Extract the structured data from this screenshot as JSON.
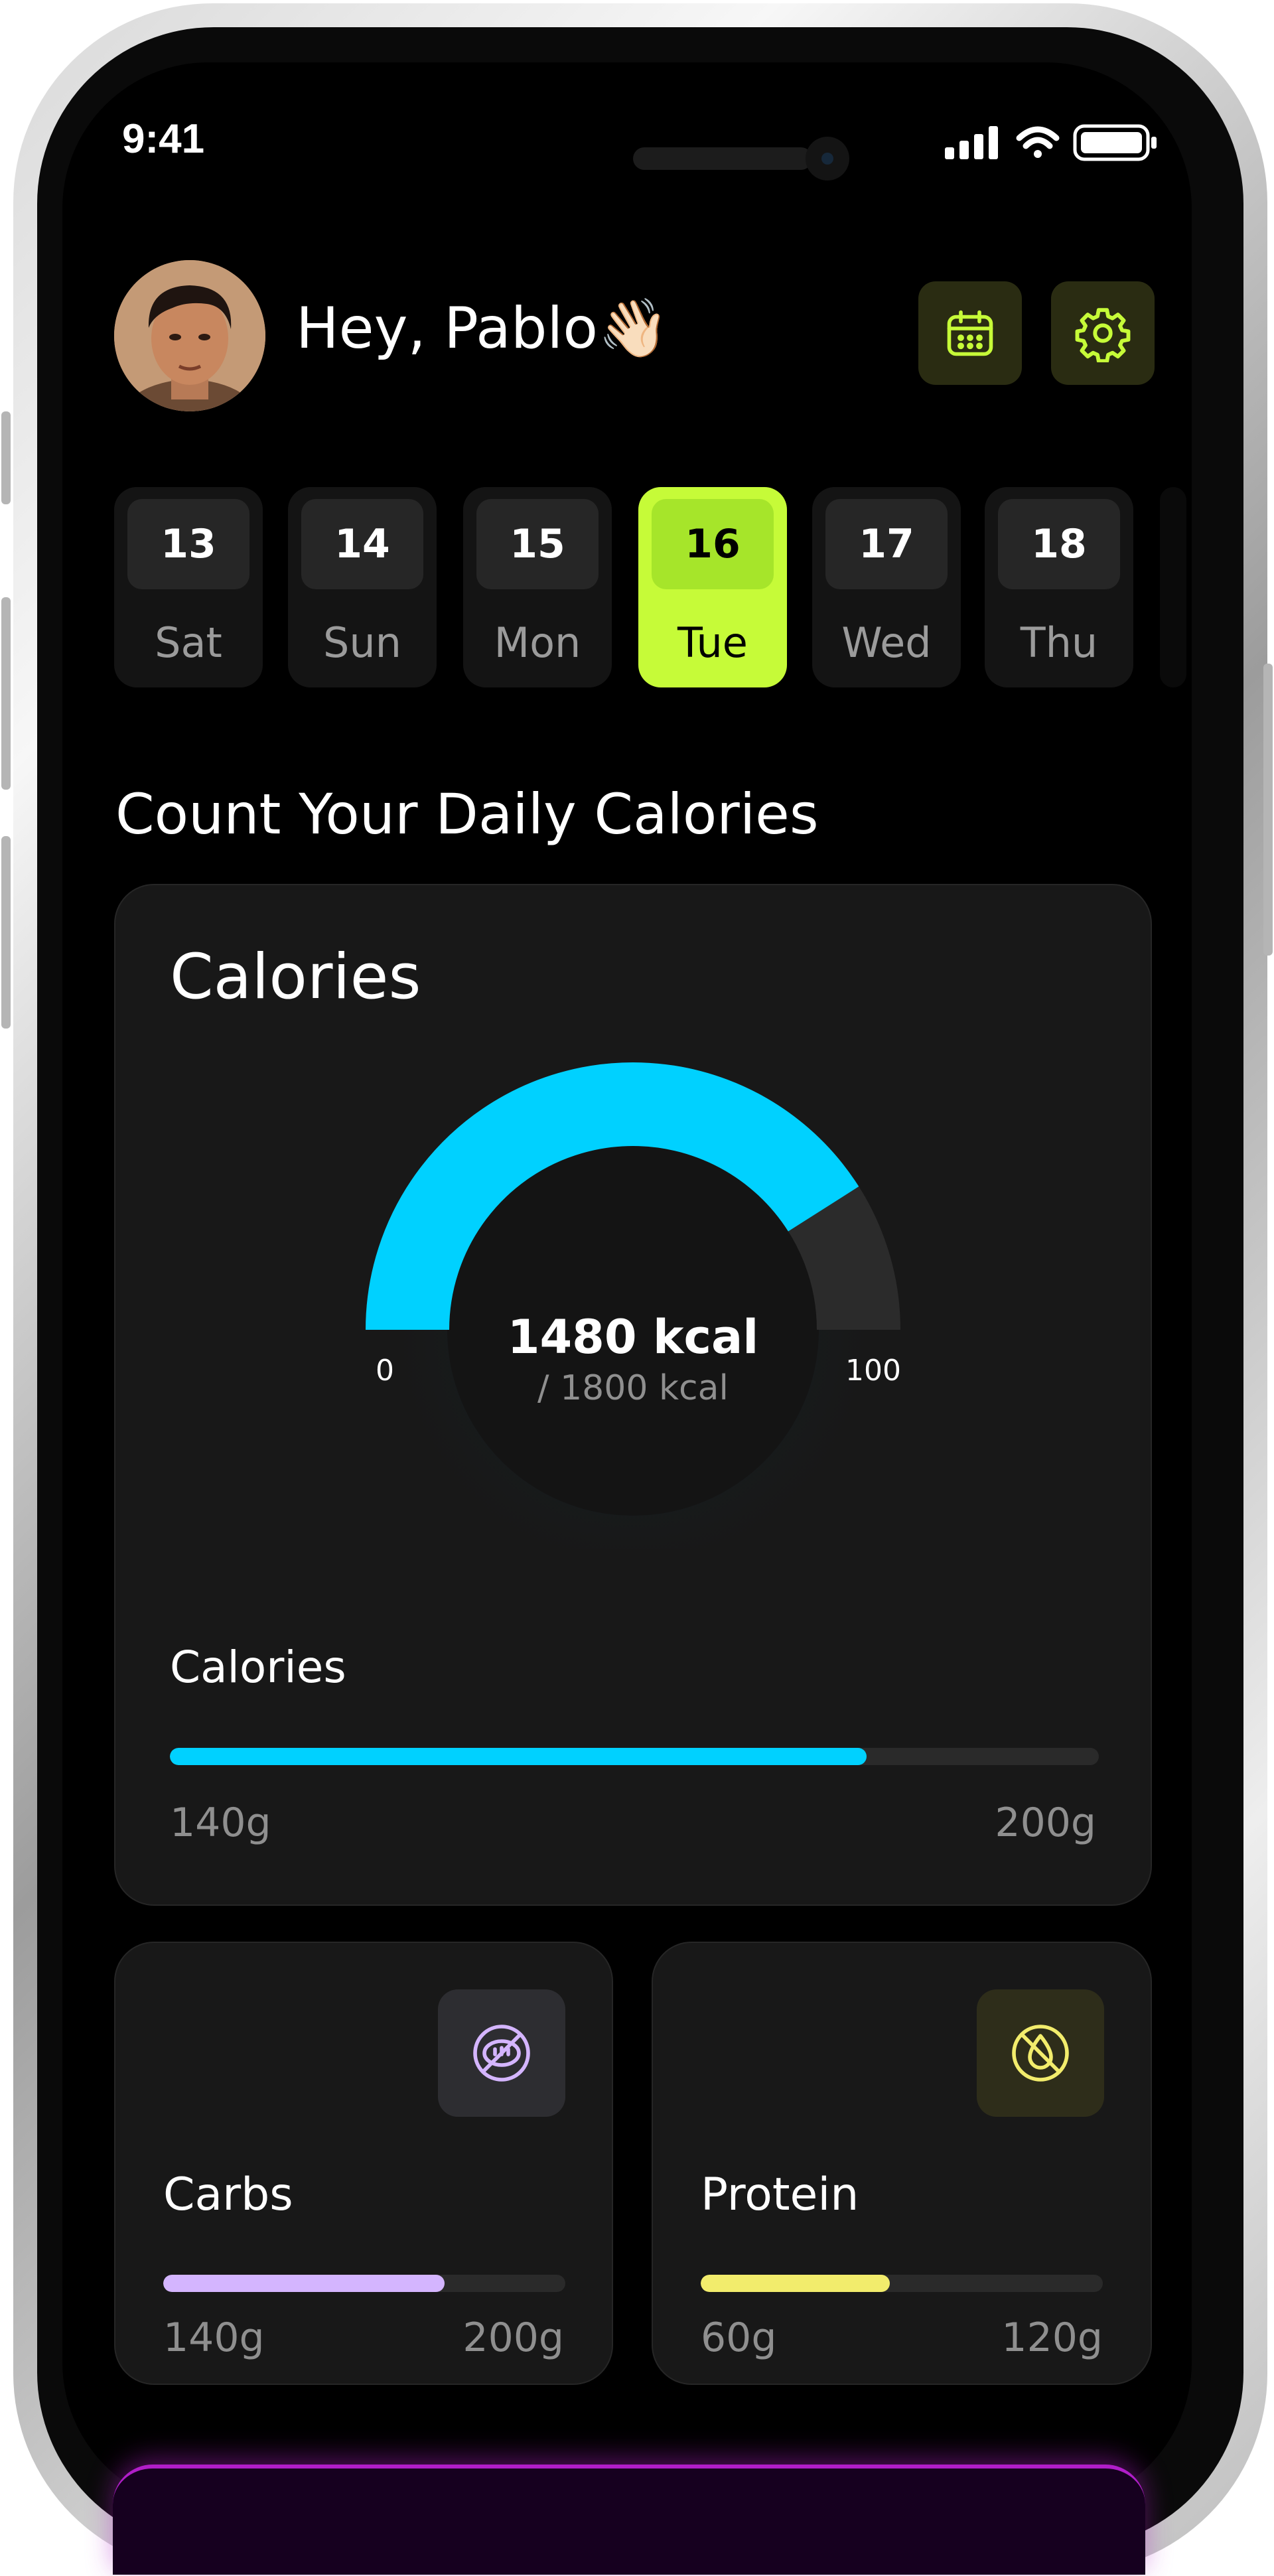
{
  "status_bar": {
    "time": "9:41"
  },
  "header": {
    "greeting": "Hey, Pablo👋🏻"
  },
  "days": [
    {
      "num": "13",
      "name": "Sat"
    },
    {
      "num": "14",
      "name": "Sun"
    },
    {
      "num": "15",
      "name": "Mon"
    },
    {
      "num": "16",
      "name": "Tue"
    },
    {
      "num": "17",
      "name": "Wed"
    },
    {
      "num": "18",
      "name": "Thu"
    }
  ],
  "selected_day_index": 3,
  "section_title": "Count Your Daily Calories",
  "calories_card": {
    "title": "Calories",
    "gauge": {
      "value_text": "1480 kcal",
      "target_text": "/ 1800 kcal",
      "min_label": "0",
      "max_label": "100",
      "fraction": 0.82,
      "color": "#00d1ff"
    },
    "bar": {
      "label": "Calories",
      "left": "140g",
      "right": "200g",
      "fraction": 0.75,
      "color": "#00d1ff"
    }
  },
  "carbs_card": {
    "label": "Carbs",
    "left": "140g",
    "right": "200g",
    "fraction": 0.7,
    "color": "#d4b5ff",
    "icon": "no-bread-icon"
  },
  "protein_card": {
    "label": "Protein",
    "left": "60g",
    "right": "120g",
    "fraction": 0.47,
    "color": "#f2ec6c",
    "icon": "no-oil-drop-icon"
  },
  "colors": {
    "accent": "#c6fb38",
    "background": "#000000",
    "card": "#181818"
  }
}
